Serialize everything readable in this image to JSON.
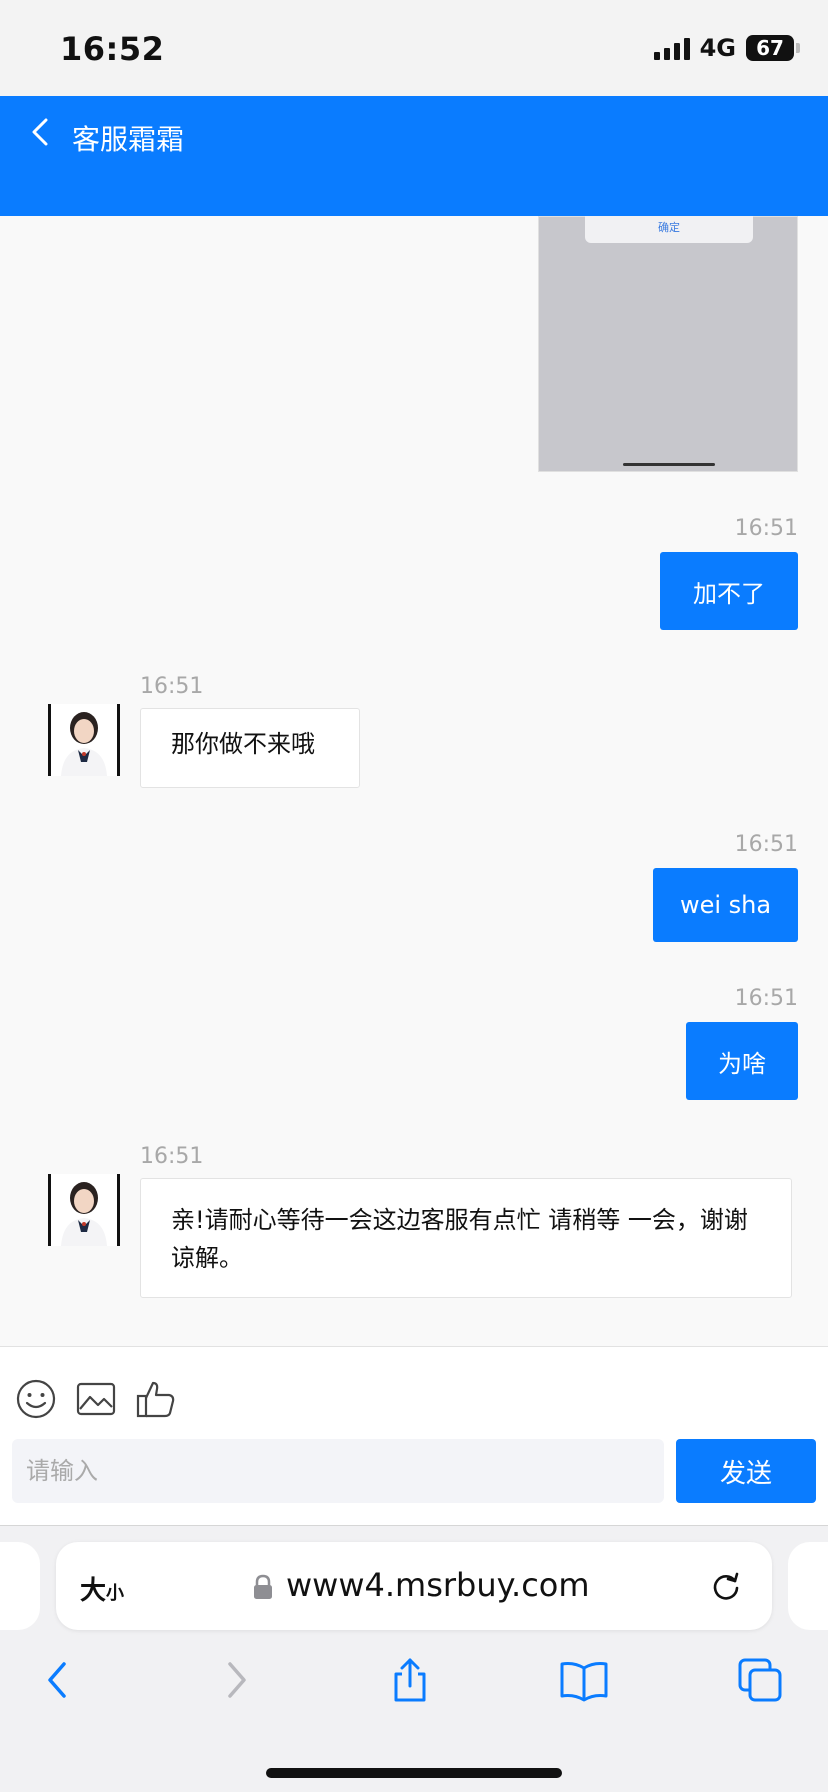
{
  "status_bar": {
    "time": "16:52",
    "network": "4G",
    "battery": "67"
  },
  "header": {
    "title": "客服霜霜"
  },
  "chat": {
    "image_dialog_button": "确定",
    "messages": [
      {
        "direction": "out",
        "time": "16:51",
        "text": "加不了"
      },
      {
        "direction": "in",
        "time": "16:51",
        "text": "那你做不来哦"
      },
      {
        "direction": "out",
        "time": "16:51",
        "text": "wei sha"
      },
      {
        "direction": "out",
        "time": "16:51",
        "text": "为啥"
      },
      {
        "direction": "in",
        "time": "16:51",
        "text": "亲!请耐心等待一会这边客服有点忙 请稍等 一会，谢谢谅解。"
      }
    ]
  },
  "composer": {
    "placeholder": "请输入",
    "send_label": "发送",
    "tools": [
      "emoji-icon",
      "image-icon",
      "thumbs-up-icon"
    ]
  },
  "browser": {
    "text_size_big": "大",
    "text_size_small": "小",
    "url": "www4.msrbuy.com"
  },
  "colors": {
    "accent": "#0a7cff",
    "bubble_in_bg": "#ffffff",
    "timestamp": "#a8a8a8"
  }
}
